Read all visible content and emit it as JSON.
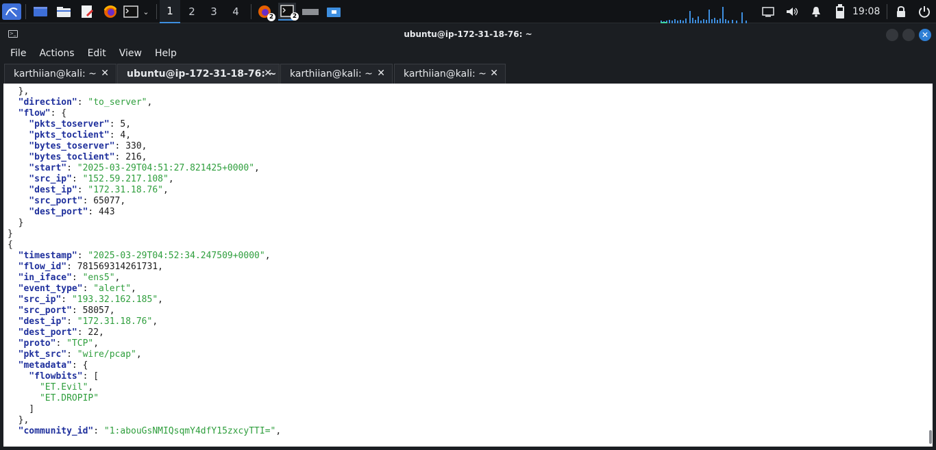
{
  "panel": {
    "workspaces": [
      "1",
      "2",
      "3",
      "4"
    ],
    "badges": [
      "2",
      "2"
    ],
    "clock": "19:08"
  },
  "window": {
    "title": "ubuntu@ip-172-31-18-76: ~"
  },
  "menu": [
    "File",
    "Actions",
    "Edit",
    "View",
    "Help"
  ],
  "tabs": [
    {
      "label": "karthiian@kali: ~"
    },
    {
      "label": "ubuntu@ip-172-31-18-76: ~"
    },
    {
      "label": "karthiian@kali: ~"
    },
    {
      "label": "karthiian@kali: ~"
    }
  ],
  "terminal": {
    "lines": [
      [
        {
          "t": "  },"
        }
      ],
      [
        {
          "t": "  \"direction\"",
          "c": "k"
        },
        {
          "t": ": "
        },
        {
          "t": "\"to_server\"",
          "c": "s"
        },
        {
          "t": ","
        }
      ],
      [
        {
          "t": "  \"flow\"",
          "c": "k"
        },
        {
          "t": ": {"
        }
      ],
      [
        {
          "t": "    \"pkts_toserver\"",
          "c": "k"
        },
        {
          "t": ": 5,"
        }
      ],
      [
        {
          "t": "    \"pkts_toclient\"",
          "c": "k"
        },
        {
          "t": ": 4,"
        }
      ],
      [
        {
          "t": "    \"bytes_toserver\"",
          "c": "k"
        },
        {
          "t": ": 330,"
        }
      ],
      [
        {
          "t": "    \"bytes_toclient\"",
          "c": "k"
        },
        {
          "t": ": 216,"
        }
      ],
      [
        {
          "t": "    \"start\"",
          "c": "k"
        },
        {
          "t": ": "
        },
        {
          "t": "\"2025-03-29T04:51:27.821425+0000\"",
          "c": "s"
        },
        {
          "t": ","
        }
      ],
      [
        {
          "t": "    \"src_ip\"",
          "c": "k"
        },
        {
          "t": ": "
        },
        {
          "t": "\"152.59.217.108\"",
          "c": "s"
        },
        {
          "t": ","
        }
      ],
      [
        {
          "t": "    \"dest_ip\"",
          "c": "k"
        },
        {
          "t": ": "
        },
        {
          "t": "\"172.31.18.76\"",
          "c": "s"
        },
        {
          "t": ","
        }
      ],
      [
        {
          "t": "    \"src_port\"",
          "c": "k"
        },
        {
          "t": ": 65077,"
        }
      ],
      [
        {
          "t": "    \"dest_port\"",
          "c": "k"
        },
        {
          "t": ": 443"
        }
      ],
      [
        {
          "t": "  }"
        }
      ],
      [
        {
          "t": "}"
        }
      ],
      [
        {
          "t": "{"
        }
      ],
      [
        {
          "t": "  \"timestamp\"",
          "c": "k"
        },
        {
          "t": ": "
        },
        {
          "t": "\"2025-03-29T04:52:34.247509+0000\"",
          "c": "s"
        },
        {
          "t": ","
        }
      ],
      [
        {
          "t": "  \"flow_id\"",
          "c": "k"
        },
        {
          "t": ": 781569314261731,"
        }
      ],
      [
        {
          "t": "  \"in_iface\"",
          "c": "k"
        },
        {
          "t": ": "
        },
        {
          "t": "\"ens5\"",
          "c": "s"
        },
        {
          "t": ","
        }
      ],
      [
        {
          "t": "  \"event_type\"",
          "c": "k"
        },
        {
          "t": ": "
        },
        {
          "t": "\"alert\"",
          "c": "s"
        },
        {
          "t": ","
        }
      ],
      [
        {
          "t": "  \"src_ip\"",
          "c": "k"
        },
        {
          "t": ": "
        },
        {
          "t": "\"193.32.162.185\"",
          "c": "s"
        },
        {
          "t": ","
        }
      ],
      [
        {
          "t": "  \"src_port\"",
          "c": "k"
        },
        {
          "t": ": 58057,"
        }
      ],
      [
        {
          "t": "  \"dest_ip\"",
          "c": "k"
        },
        {
          "t": ": "
        },
        {
          "t": "\"172.31.18.76\"",
          "c": "s"
        },
        {
          "t": ","
        }
      ],
      [
        {
          "t": "  \"dest_port\"",
          "c": "k"
        },
        {
          "t": ": 22,"
        }
      ],
      [
        {
          "t": "  \"proto\"",
          "c": "k"
        },
        {
          "t": ": "
        },
        {
          "t": "\"TCP\"",
          "c": "s"
        },
        {
          "t": ","
        }
      ],
      [
        {
          "t": "  \"pkt_src\"",
          "c": "k"
        },
        {
          "t": ": "
        },
        {
          "t": "\"wire/pcap\"",
          "c": "s"
        },
        {
          "t": ","
        }
      ],
      [
        {
          "t": "  \"metadata\"",
          "c": "k"
        },
        {
          "t": ": {"
        }
      ],
      [
        {
          "t": "    \"flowbits\"",
          "c": "k"
        },
        {
          "t": ": ["
        }
      ],
      [
        {
          "t": "      "
        },
        {
          "t": "\"ET.Evil\"",
          "c": "s"
        },
        {
          "t": ","
        }
      ],
      [
        {
          "t": "      "
        },
        {
          "t": "\"ET.DROPIP\"",
          "c": "s"
        }
      ],
      [
        {
          "t": "    ]"
        }
      ],
      [
        {
          "t": "  },"
        }
      ],
      [
        {
          "t": "  \"community_id\"",
          "c": "k"
        },
        {
          "t": ": "
        },
        {
          "t": "\"1:abouGsNMIQsqmY4dfY15zxcyTTI=\"",
          "c": "s"
        },
        {
          "t": ","
        }
      ]
    ]
  }
}
